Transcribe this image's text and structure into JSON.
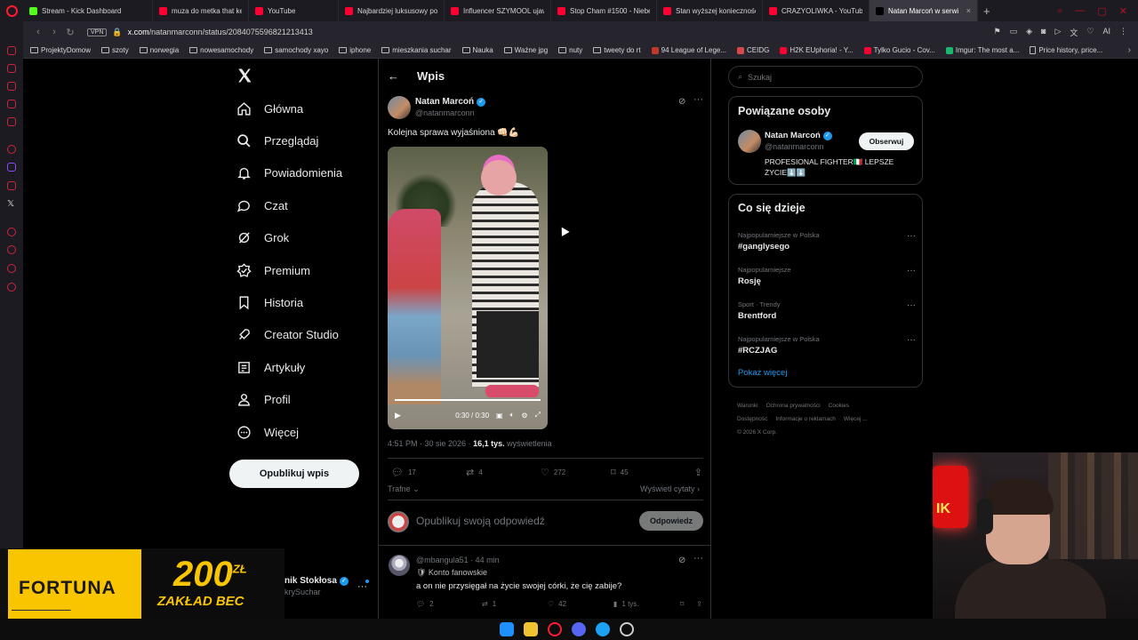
{
  "browser": {
    "tabs": [
      {
        "label": "Stream - Kick Dashboard",
        "color": "#53fc18",
        "width": 146
      },
      {
        "label": "muza do metka that ke",
        "color": "#ff0033",
        "width": 108
      },
      {
        "label": "YouTube",
        "color": "#ff0033",
        "width": 101
      },
      {
        "label": "Najbardziej luksusowy poc",
        "color": "#ff0033",
        "width": 119
      },
      {
        "label": "Influencer SZYMOOL ujaw",
        "color": "#ff0033",
        "width": 120
      },
      {
        "label": "Stop Cham #1500 - Niebez",
        "color": "#ff0033",
        "width": 119
      },
      {
        "label": "Stan wyższej konieczności",
        "color": "#ff0033",
        "width": 119
      },
      {
        "label": "CRAZYOLIWKA - YouTube",
        "color": "#ff0033",
        "width": 120
      },
      {
        "label": "Natan Marcoń w serwisie ",
        "color": "#000000",
        "width": 122,
        "active": true
      }
    ],
    "new_tab": "+",
    "url_host": "x.com",
    "url_path": "/natanmarconn/status/2084075596821213413",
    "vpn": "VPN",
    "ai_label": "AI",
    "bookmarks": [
      {
        "label": "ProjektyDomow",
        "type": "folder"
      },
      {
        "label": "szoty",
        "type": "folder"
      },
      {
        "label": "norwegia",
        "type": "folder"
      },
      {
        "label": "nowesamochody",
        "type": "folder"
      },
      {
        "label": "samochody xayo",
        "type": "folder"
      },
      {
        "label": "iphone",
        "type": "folder"
      },
      {
        "label": "mieszkania suchar",
        "type": "folder"
      },
      {
        "label": "Nauka",
        "type": "folder"
      },
      {
        "label": "Ważne jpg",
        "type": "folder"
      },
      {
        "label": "nuty",
        "type": "folder"
      },
      {
        "label": "tweety do rt",
        "type": "folder"
      },
      {
        "label": "94 League of Lege...",
        "type": "site",
        "color": "#c0392b"
      },
      {
        "label": "CEIDG",
        "type": "site",
        "color": "#d84a4a"
      },
      {
        "label": "H2K EUphoria! - Y...",
        "type": "site",
        "color": "#ff0033"
      },
      {
        "label": "Tylko Gucio - Cov...",
        "type": "site",
        "color": "#ff0033"
      },
      {
        "label": "Imgur: The most a...",
        "type": "site",
        "color": "#1bb76e"
      },
      {
        "label": "Price history, price...",
        "type": "doc"
      }
    ]
  },
  "x": {
    "nav": [
      {
        "key": "home",
        "label": "Główna",
        "icon": "home-icon"
      },
      {
        "key": "explore",
        "label": "Przeglądaj",
        "icon": "search-icon"
      },
      {
        "key": "notifications",
        "label": "Powiadomienia",
        "icon": "bell-icon"
      },
      {
        "key": "chat",
        "label": "Czat",
        "icon": "chat-icon"
      },
      {
        "key": "grok",
        "label": "Grok",
        "icon": "grok-icon"
      },
      {
        "key": "premium",
        "label": "Premium",
        "icon": "verified-icon"
      },
      {
        "key": "history",
        "label": "Historia",
        "icon": "bookmark-icon"
      },
      {
        "key": "creator",
        "label": "Creator Studio",
        "icon": "rocket-icon"
      },
      {
        "key": "articles",
        "label": "Artykuły",
        "icon": "article-icon"
      },
      {
        "key": "profile",
        "label": "Profil",
        "icon": "person-icon"
      },
      {
        "key": "more",
        "label": "Więcej",
        "icon": "more-circle-icon"
      }
    ],
    "post_button": "Opublikuj wpis",
    "account": {
      "name": "nik Stokłosa",
      "handle": "krySuchar"
    },
    "header_title": "Wpis",
    "tweet": {
      "name": "Natan Marcoń",
      "handle": "@natanmarconn",
      "text": "Kolejna sprawa wyjaśniona 👊🏻💪🏻",
      "video_time": "0:30 / 0:30",
      "video_progress": 1.0,
      "time": "4:51 PM · 30 sie 2026 · ",
      "views_count": "16,1 tys.",
      "views_label": " wyświetlenia",
      "replies": "17",
      "reposts": "4",
      "likes": "272",
      "bookmarks": "45",
      "sort_label": "Trafne",
      "quotes_label": "Wyświetl cytaty"
    },
    "reply_placeholder": "Opublikuj swoją odpowiedź",
    "reply_button": "Odpowiedz",
    "reply": {
      "header": "@mbangula51 · 44 min",
      "badge": "🛡 Konto fanowskie",
      "text": "a on nie przysięgał na życie swojej córki, że cię zabije?",
      "replies": "2",
      "reposts": "1",
      "likes": "42",
      "views": "1 tys."
    },
    "search_placeholder": "Szukaj",
    "related": {
      "title": "Powiązane osoby",
      "name": "Natan Marcoń",
      "handle": "@natanmarconn",
      "follow": "Obserwuj",
      "bio": "PROFESIONAL FIGHTER🇮🇹 LEPSZE ŻYCIE⬇️⬇️"
    },
    "trends": {
      "title": "Co się dzieje",
      "items": [
        {
          "category": "Najpopularniejsze w Polska",
          "name": "#ganglysego"
        },
        {
          "category": "Najpopularniejsze",
          "name": "Rosję"
        },
        {
          "category": "Sport · Trendy",
          "name": "Brentford"
        },
        {
          "category": "Najpopularniejsze w Polska",
          "name": "#RCZJAG"
        }
      ],
      "show_more": "Pokaż więcej"
    },
    "footer": [
      "Warunki",
      "Ochrona prywatności",
      "Cookies",
      "Dostępność",
      "Informacje o reklamach",
      "Więcej ...",
      "© 2026 X Corp."
    ]
  },
  "ad": {
    "brand": "FORTUNA",
    "amount": "200",
    "currency": "ZŁ",
    "subtitle": "ZAKŁAD BEC"
  },
  "webcam": {
    "neon_text": "IK"
  },
  "colors": {
    "accent": "#1d9bf0",
    "ad_yellow": "#f9c400",
    "opera_red": "#ff1b2d"
  }
}
